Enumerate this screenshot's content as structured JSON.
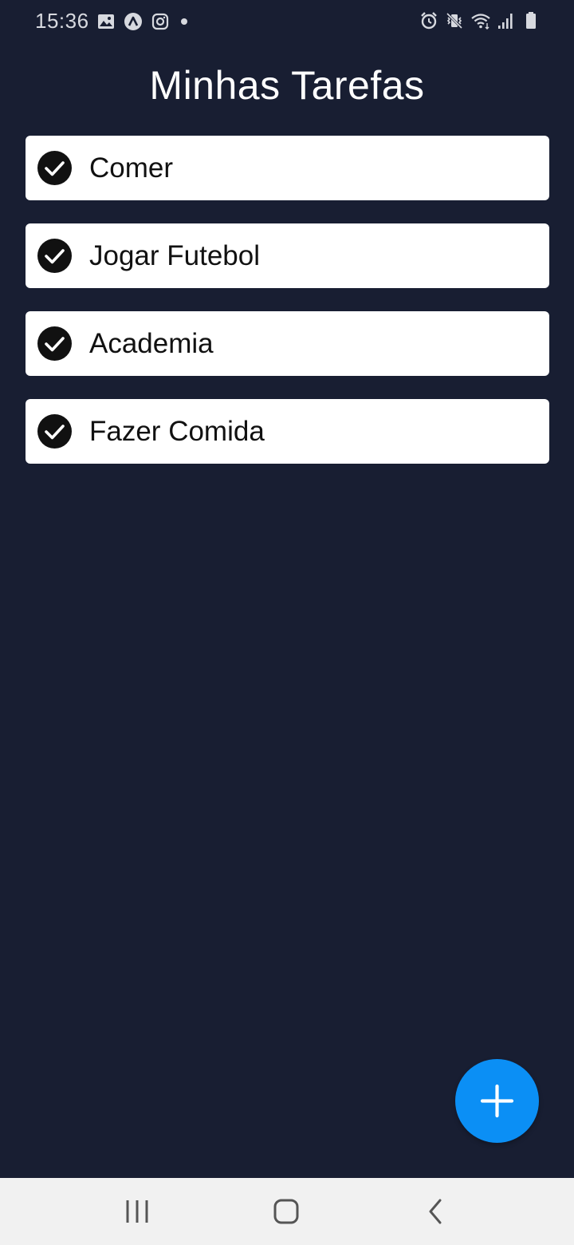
{
  "status_bar": {
    "time": "15:36",
    "left_icons": [
      "gallery-icon",
      "app-a-icon",
      "instagram-icon",
      "notification-dot-icon"
    ],
    "right_icons": [
      "alarm-icon",
      "vibrate-mute-icon",
      "wifi-icon",
      "signal-icon",
      "battery-icon"
    ]
  },
  "header": {
    "title": "Minhas Tarefas"
  },
  "tasks": [
    {
      "label": "Comer",
      "done": true
    },
    {
      "label": "Jogar Futebol",
      "done": true
    },
    {
      "label": "Academia",
      "done": true
    },
    {
      "label": "Fazer Comida",
      "done": true
    }
  ],
  "fab": {
    "icon": "plus-icon",
    "color": "#0b8ff5"
  },
  "nav_bar": {
    "buttons": [
      "recent-apps-icon",
      "home-icon",
      "back-icon"
    ]
  },
  "colors": {
    "background": "#181e32",
    "card": "#ffffff",
    "accent": "#0b8ff5"
  }
}
